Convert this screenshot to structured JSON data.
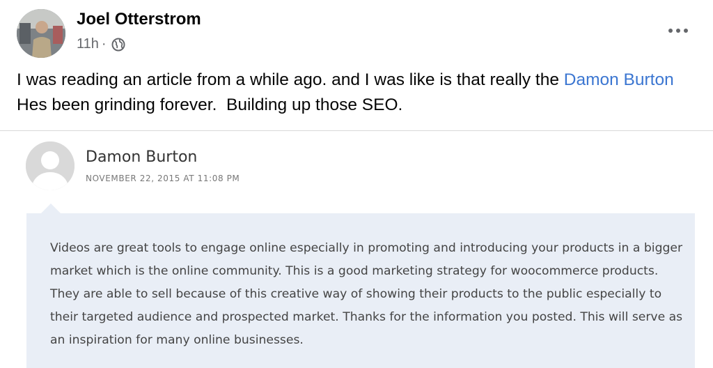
{
  "post": {
    "author": "Joel Otterstrom",
    "time": "11h",
    "separator": "·",
    "text_before": "I was reading an article from a while ago. and I was like is that really the ",
    "mention": "Damon Burton",
    "text_after": "  Hes been grinding forever.  Building up those SEO."
  },
  "comment": {
    "author": "Damon Burton",
    "date": "NOVEMBER 22, 2015 AT 11:08 PM",
    "body": "Videos are great tools to engage online especially in promoting and introducing your products in a bigger market which is the online community. This is a good marketing strategy for woocommerce products. They are able to sell because of this creative way of showing their products to the public especially to their targeted audience and prospected market. Thanks for the information you posted. This will serve as an inspiration for many online businesses."
  },
  "icons": {
    "audience": "globe-icon",
    "menu": "more-horizontal-icon",
    "avatar_placeholder": "default-user-icon"
  },
  "colors": {
    "mention": "#3b76d1",
    "meta": "#65676b",
    "comment_bubble": "#e9eef6"
  }
}
